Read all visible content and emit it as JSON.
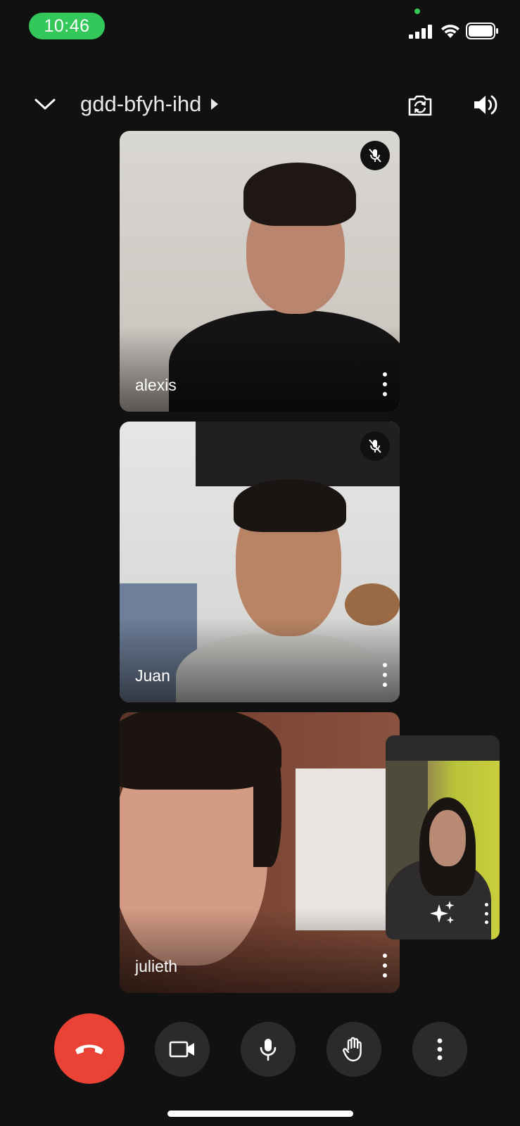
{
  "status_bar": {
    "time": "10:46"
  },
  "header": {
    "meeting_code": "gdd-bfyh-ihd"
  },
  "participants": [
    {
      "name": "alexis",
      "muted": true
    },
    {
      "name": "Juan",
      "muted": true
    },
    {
      "name": "julieth",
      "muted": false
    }
  ],
  "colors": {
    "end_call": "#ea4335",
    "time_pill": "#34c759",
    "control_bg": "#2b2b2b",
    "background": "#111111"
  },
  "icons": {
    "header": [
      "chevron-down-icon",
      "camera-switch-icon",
      "speaker-icon"
    ],
    "controls": [
      "hang-up-icon",
      "video-camera-icon",
      "microphone-icon",
      "raise-hand-icon",
      "more-vert-icon"
    ],
    "tile": [
      "mic-off-icon",
      "more-vert-icon"
    ],
    "self_view": [
      "sparkle-effects-icon",
      "more-vert-icon"
    ]
  }
}
